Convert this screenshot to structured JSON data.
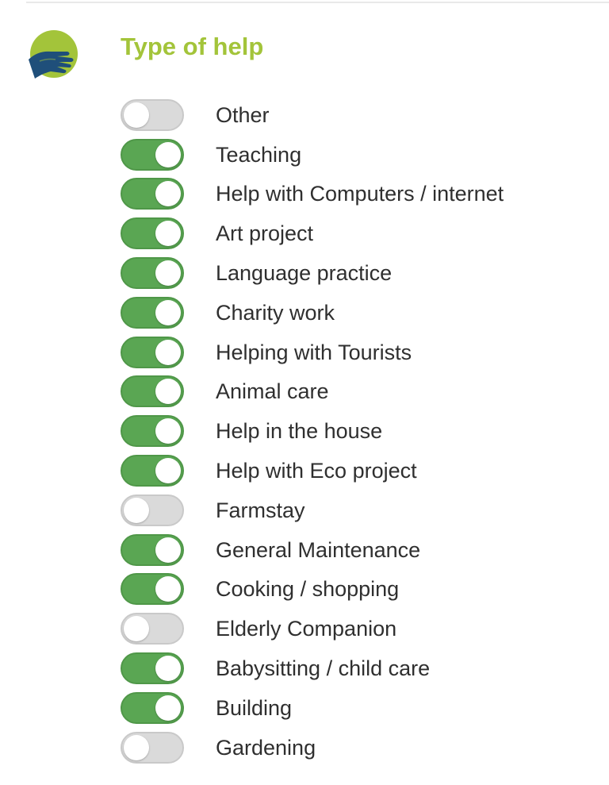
{
  "section": {
    "title": "Type of help",
    "icon": "helping-hand-icon",
    "colors": {
      "title": "#a3c43a",
      "icon_circle": "#a3c43a",
      "icon_hand": "#1f4f7a",
      "toggle_on": "#5aa653",
      "toggle_off": "#dadada"
    }
  },
  "options": [
    {
      "label": "Other",
      "checked": false
    },
    {
      "label": "Teaching",
      "checked": true
    },
    {
      "label": "Help with Computers / internet",
      "checked": true
    },
    {
      "label": "Art project",
      "checked": true
    },
    {
      "label": "Language practice",
      "checked": true
    },
    {
      "label": "Charity work",
      "checked": true
    },
    {
      "label": "Helping with Tourists",
      "checked": true
    },
    {
      "label": "Animal care",
      "checked": true
    },
    {
      "label": "Help in the house",
      "checked": true
    },
    {
      "label": "Help with Eco project",
      "checked": true
    },
    {
      "label": "Farmstay",
      "checked": false
    },
    {
      "label": "General Maintenance",
      "checked": true
    },
    {
      "label": "Cooking / shopping",
      "checked": true
    },
    {
      "label": "Elderly Companion",
      "checked": false
    },
    {
      "label": "Babysitting / child care",
      "checked": true
    },
    {
      "label": "Building",
      "checked": true
    },
    {
      "label": "Gardening",
      "checked": false
    }
  ]
}
